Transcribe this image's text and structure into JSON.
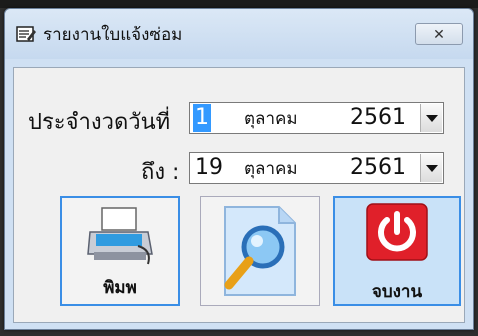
{
  "window": {
    "title": "รายงานใบแจ้งซ่อม",
    "close_label": "✕"
  },
  "form": {
    "from_label": "ประจำงวดวันที่",
    "from_day": "1",
    "from_month": "ตุลาคม",
    "from_year": "2561",
    "to_label": "ถึง :",
    "to_day": "19",
    "to_month": "ตุลาคม",
    "to_year": "2561"
  },
  "buttons": {
    "print_label": "พิมพ",
    "exit_label": "จบงาน"
  },
  "colors": {
    "focus_border": "#3a8ee6",
    "power_red": "#e0202a",
    "selection": "#3399ff"
  },
  "icons": {
    "app": "report-icon",
    "print": "printer-icon",
    "preview": "magnifier-document-icon",
    "exit": "power-icon"
  }
}
